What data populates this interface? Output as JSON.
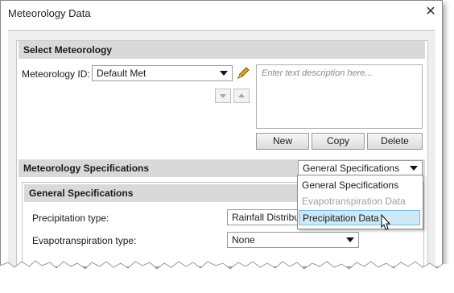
{
  "window": {
    "title": "Meteorology Data",
    "close_glyph": "✕"
  },
  "select_section": {
    "header": "Select Meteorology",
    "met_id_label": "Meteorology ID:",
    "met_id_value": "Default Met",
    "description_placeholder": "Enter text description here...",
    "buttons": {
      "new": "New",
      "copy": "Copy",
      "delete": "Delete"
    }
  },
  "specs_section": {
    "header": "Meteorology Specifications",
    "selected_value": "General Specifications",
    "dropdown_options": [
      {
        "label": "General Specifications",
        "state": "normal"
      },
      {
        "label": "Evapotranspiration Data",
        "state": "disabled"
      },
      {
        "label": "Precipitation Data",
        "state": "highlighted"
      }
    ]
  },
  "general_specs": {
    "header": "General Specifications",
    "precip_label": "Precipitation type:",
    "precip_value": "Rainfall Distribut",
    "evapo_label": "Evapotranspiration type:",
    "evapo_value": "None"
  },
  "icons": [
    "pencil-icon",
    "move-down-icon",
    "move-up-icon",
    "close-icon",
    "mouse-cursor-icon"
  ],
  "colors": {
    "section_header_bg": "#d9d9d9",
    "highlight_bg": "#cde8f7",
    "highlight_border": "#7fbbe0",
    "pencil": "#e0a020"
  }
}
